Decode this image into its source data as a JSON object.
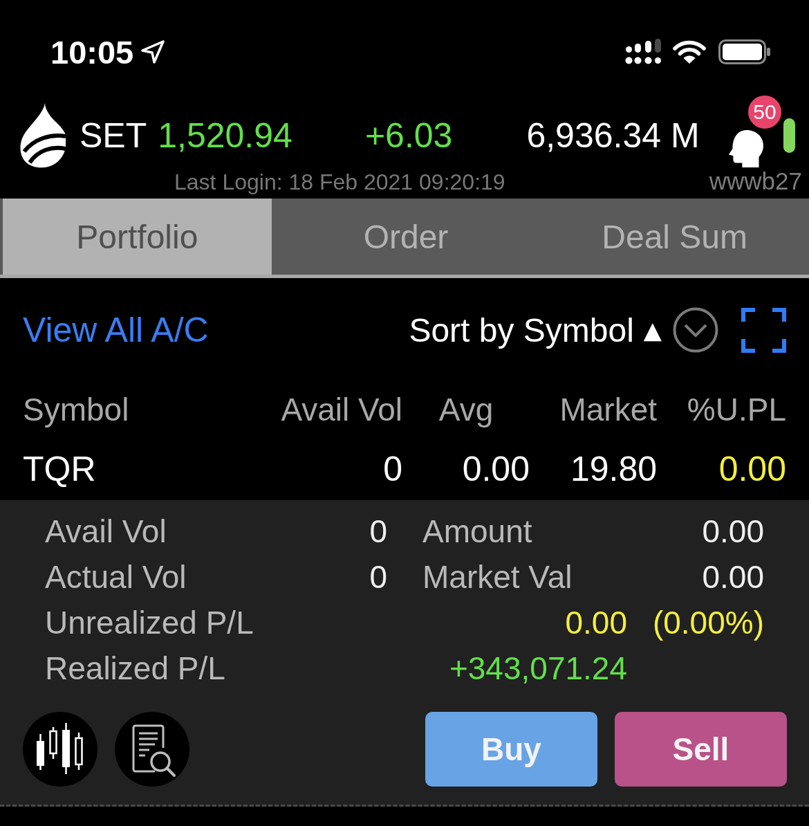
{
  "status_bar": {
    "time": "10:05"
  },
  "header": {
    "index": {
      "name": "SET",
      "value": "1,520.94",
      "change": "+6.03",
      "color": "#62e04a"
    },
    "volume": "6,936.34 M",
    "notifications": "50",
    "connected": true,
    "last_login": "Last Login: 18 Feb 2021 09:20:19",
    "user": "wwwb27"
  },
  "tabs": [
    {
      "label": "Portfolio",
      "selected": true
    },
    {
      "label": "Order",
      "selected": false
    },
    {
      "label": "Deal Sum",
      "selected": false
    }
  ],
  "toolbar": {
    "account_link": "View All A/C",
    "sort": {
      "label": "Sort by Symbol",
      "arrow": "▲"
    }
  },
  "table": {
    "columns": [
      "Symbol",
      "Avail Vol",
      "Avg",
      "Market",
      "%U.PL"
    ],
    "rows": [
      {
        "cells": [
          "TQR",
          "0",
          "0.00",
          "19.80",
          "0.00"
        ],
        "color": "#f3f03c",
        "expanded": true,
        "details": [
          {
            "kind": "pair",
            "label": "Avail Vol",
            "value": "0",
            "label_2": "Amount",
            "value_2": "0.00"
          },
          {
            "kind": "pair",
            "label": "Actual Vol",
            "value": "0",
            "label_2": "Market Val",
            "value_2": "0.00"
          },
          {
            "kind": "pl",
            "label": "Unrealized P/L",
            "value": "0.00",
            "percent": "(0.00%)",
            "color": "#f3f03c"
          },
          {
            "kind": "pl",
            "label": "Realized P/L",
            "value": "+343,071.24",
            "color": "#62e04a"
          }
        ]
      }
    ]
  },
  "actions": [
    {
      "kind": "buy",
      "label": "Buy"
    },
    {
      "kind": "sell",
      "label": "Sell"
    }
  ]
}
